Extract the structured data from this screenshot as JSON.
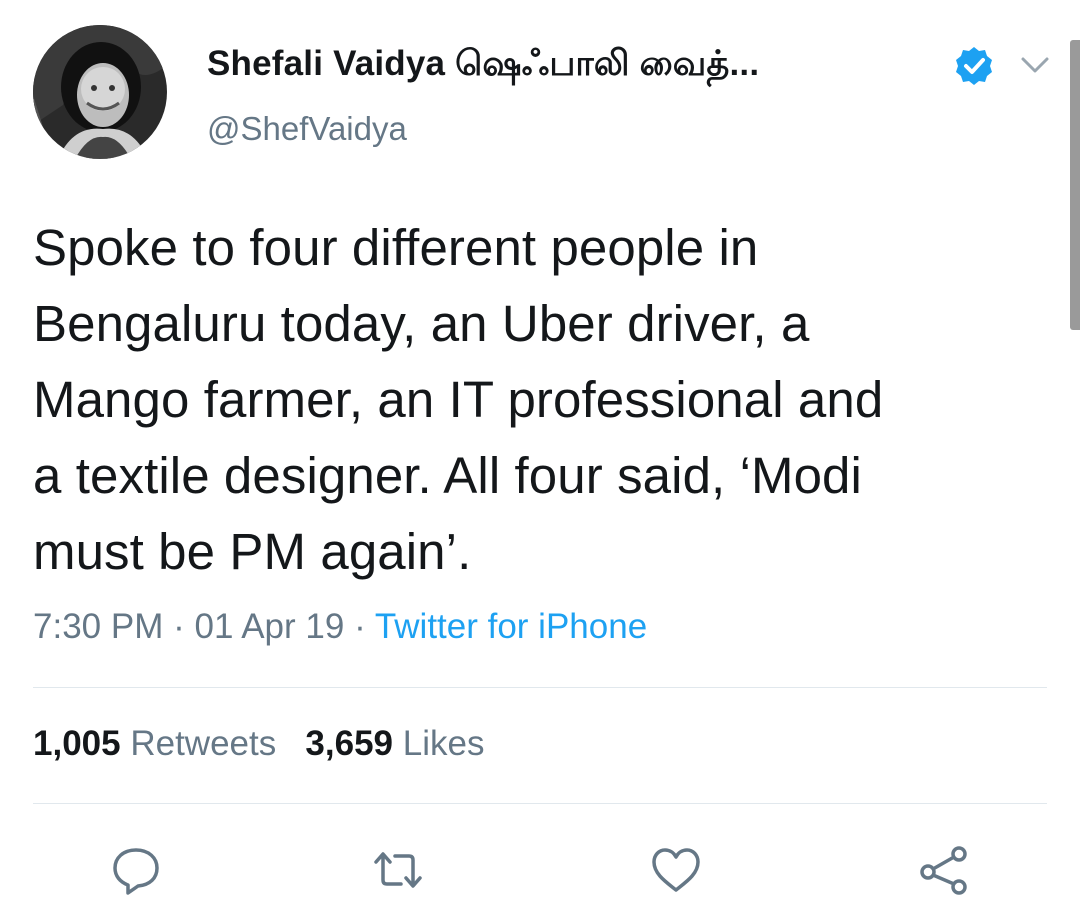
{
  "user": {
    "display_name": "Shefali Vaidya ஷெஃபாலி வைத்...",
    "handle": "@ShefVaidya",
    "verified": true
  },
  "tweet": {
    "text": "Spoke to four different people in\nBengaluru today, an Uber driver, a\nMango farmer, an IT professional and\na textile designer. All four said, ‘Modi\nmust be PM again’.",
    "time": "7:30 PM",
    "date": "01 Apr 19",
    "separator": "·",
    "source": "Twitter for iPhone"
  },
  "stats": {
    "retweets_count": "1,005",
    "retweets_label": "Retweets",
    "likes_count": "3,659",
    "likes_label": "Likes"
  },
  "actions": [
    "reply-icon",
    "retweet-icon",
    "like-icon",
    "share-icon"
  ],
  "colors": {
    "text": "#14171a",
    "secondary": "#657786",
    "accent": "#1da1f2",
    "divider": "#e1e8ed"
  }
}
